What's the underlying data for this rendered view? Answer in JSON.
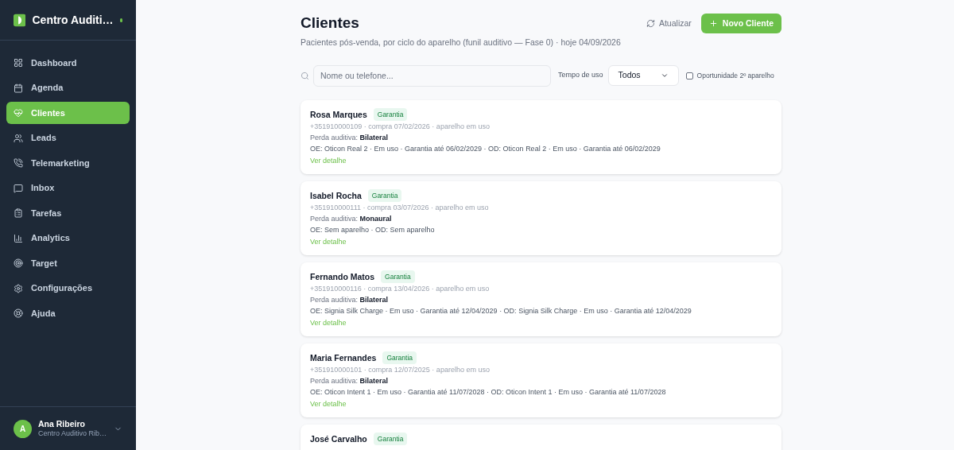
{
  "sidebar": {
    "brand": "Centro Auditi…",
    "items": [
      {
        "label": "Dashboard",
        "selected": false
      },
      {
        "label": "Agenda",
        "selected": false
      },
      {
        "label": "Clientes",
        "selected": true
      },
      {
        "label": "Leads",
        "selected": false
      },
      {
        "label": "Telemarketing",
        "selected": false
      },
      {
        "label": "Inbox",
        "selected": false
      },
      {
        "label": "Tarefas",
        "selected": false
      },
      {
        "label": "Analytics",
        "selected": false
      },
      {
        "label": "Target",
        "selected": false
      },
      {
        "label": "Configurações",
        "selected": false
      },
      {
        "label": "Ajuda",
        "selected": false
      }
    ],
    "user": {
      "initial": "A",
      "name": "Ana Ribeiro",
      "org": "Centro Auditivo Rib…"
    }
  },
  "header": {
    "title": "Clientes",
    "subtitle": "Pacientes pós-venda, por ciclo do aparelho (funil auditivo — Fase 0) · hoje 04/09/2026",
    "refresh": "Atualizar",
    "new_button": "Novo Cliente"
  },
  "filters": {
    "search": {
      "placeholder": "Nome ou telefone..."
    },
    "usage_label": "Tempo de uso",
    "usage_value": "Todos",
    "opportunity": {
      "label": "Oportunidade 2º aparelho",
      "checked": false
    }
  },
  "clients": [
    {
      "name": "Rosa Marques",
      "badge": "Garantia",
      "meta": "+351910000109 · compra 07/02/2026 · aparelho em uso",
      "loss": "Perda auditiva: **Bilateral**",
      "devices": "OE: Oticon Real 2 · Em uso · Garantia até 06/02/2029 · OD: Oticon Real 2 · Em uso · Garantia até 06/02/2029",
      "link": "Ver detalhe"
    },
    {
      "name": "Isabel Rocha",
      "badge": "Garantia",
      "meta": "+351910000111 · compra 03/07/2026 · aparelho em uso",
      "loss": "Perda auditiva: **Monaural**",
      "devices": "OE: Sem aparelho · OD: Sem aparelho",
      "link": "Ver detalhe"
    },
    {
      "name": "Fernando Matos",
      "badge": "Garantia",
      "meta": "+351910000116 · compra 13/04/2026 · aparelho em uso",
      "loss": "Perda auditiva: **Bilateral**",
      "devices": "OE: Signia Silk Charge · Em uso · Garantia até 12/04/2029 · OD: Signia Silk Charge · Em uso · Garantia até 12/04/2029",
      "link": "Ver detalhe"
    },
    {
      "name": "Maria Fernandes",
      "badge": "Garantia",
      "meta": "+351910000101 · compra 12/07/2025 · aparelho em uso",
      "loss": "Perda auditiva: **Bilateral**",
      "devices": "OE: Oticon Intent 1 · Em uso · Garantia até 11/07/2028 · OD: Oticon Intent 1 · Em uso · Garantia até 11/07/2028",
      "link": "Ver detalhe"
    },
    {
      "name": "José Carvalho",
      "badge": "Garantia"
    }
  ]
}
